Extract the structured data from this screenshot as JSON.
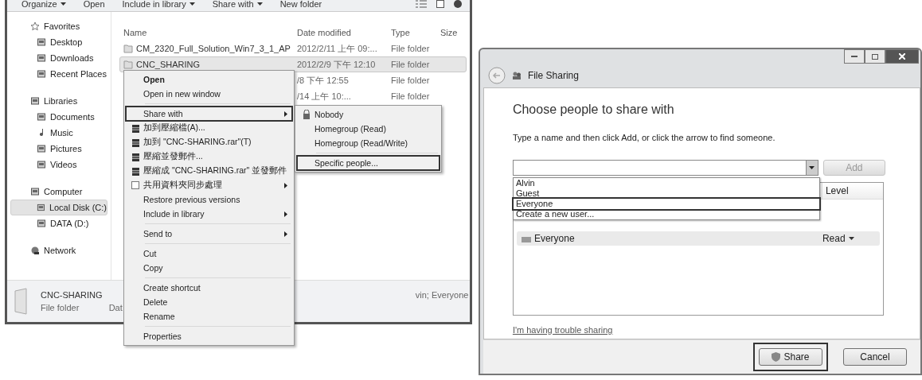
{
  "explorer": {
    "toolbar": [
      {
        "label": "Organize",
        "dropdown": true
      },
      {
        "label": "Open",
        "dropdown": false
      },
      {
        "label": "Include in library",
        "dropdown": true
      },
      {
        "label": "Share with",
        "dropdown": true
      },
      {
        "label": "New folder",
        "dropdown": false
      }
    ],
    "sidebar": [
      {
        "label": "Favorites",
        "children": [
          {
            "label": "Desktop",
            "selected": false
          },
          {
            "label": "Downloads",
            "selected": false
          },
          {
            "label": "Recent Places",
            "selected": false
          }
        ]
      },
      {
        "label": "Libraries",
        "children": [
          {
            "label": "Documents",
            "selected": false
          },
          {
            "label": "Music",
            "selected": false
          },
          {
            "label": "Pictures",
            "selected": false
          },
          {
            "label": "Videos",
            "selected": false
          }
        ]
      },
      {
        "label": "Computer",
        "children": [
          {
            "label": "Local Disk (C:)",
            "selected": true
          },
          {
            "label": "DATA (D:)",
            "selected": false
          }
        ]
      },
      {
        "label": "Network"
      }
    ],
    "columns": [
      "Name",
      "Date modified",
      "Type",
      "Size"
    ],
    "rows": [
      {
        "name": "CM_2320_Full_Solution_Win7_3_1_AP",
        "date": "2012/2/11 上午 09:...",
        "type": "File folder",
        "selected": false
      },
      {
        "name": "CNC_SHARING",
        "date": "2012/2/9 下午 12:10",
        "type": "File folder",
        "selected": true
      },
      {
        "date": "/8 下午 12:55",
        "type": "File folder",
        "selected": false
      },
      {
        "date": "/14 上午 10:...",
        "type": "File folder",
        "selected": false
      }
    ],
    "status": {
      "name": "CNC-SHARING",
      "type": "File folder",
      "date_label": "Dat",
      "shared_with": "vin; Everyone"
    }
  },
  "context_menu": {
    "items": [
      {
        "kind": "item",
        "label": "Open",
        "bold": true
      },
      {
        "kind": "item",
        "label": "Open in new window"
      },
      {
        "kind": "separator"
      },
      {
        "kind": "submenu",
        "label": "Share with",
        "annotated": true
      },
      {
        "kind": "item",
        "label": "加到壓縮檔(A)..."
      },
      {
        "kind": "item",
        "label": "加到 \"CNC-SHARING.rar\"(T)"
      },
      {
        "kind": "item",
        "label": "壓縮並發郵件..."
      },
      {
        "kind": "item",
        "label": "壓縮成 \"CNC-SHARING.rar\" 並發郵件"
      },
      {
        "kind": "submenu",
        "label": "共用資料夾同步處理"
      },
      {
        "kind": "item",
        "label": "Restore previous versions"
      },
      {
        "kind": "submenu",
        "label": "Include in library"
      },
      {
        "kind": "separator"
      },
      {
        "kind": "submenu",
        "label": "Send to"
      },
      {
        "kind": "separator"
      },
      {
        "kind": "item",
        "label": "Cut"
      },
      {
        "kind": "item",
        "label": "Copy"
      },
      {
        "kind": "separator"
      },
      {
        "kind": "item",
        "label": "Create shortcut"
      },
      {
        "kind": "item",
        "label": "Delete"
      },
      {
        "kind": "item",
        "label": "Rename"
      },
      {
        "kind": "separator"
      },
      {
        "kind": "item",
        "label": "Properties"
      }
    ]
  },
  "share_submenu": {
    "items": [
      {
        "kind": "item",
        "label": "Nobody",
        "annotated": false
      },
      {
        "kind": "item",
        "label": "Homegroup (Read)",
        "annotated": false
      },
      {
        "kind": "item",
        "label": "Homegroup (Read/Write)",
        "annotated": false
      },
      {
        "kind": "separator"
      },
      {
        "kind": "item",
        "label": "Specific people...",
        "annotated": true
      }
    ]
  },
  "dialog": {
    "title": "File Sharing",
    "heading": "Choose people to share with",
    "instruction": "Type a name and then click Add, or click the arrow to find someone.",
    "add_button": {
      "label": "Add",
      "disabled": true
    },
    "dropdown": [
      {
        "label": "Alvin",
        "annotated": false
      },
      {
        "label": "Guest",
        "annotated": false
      },
      {
        "label": "Everyone",
        "annotated": true
      },
      {
        "label": "Create a new user..."
      }
    ],
    "table": {
      "column_2": "Level",
      "rows": [
        {
          "name": "Everyone",
          "level": "Read"
        }
      ]
    },
    "link": "I'm having trouble sharing",
    "buttons": [
      {
        "label": "Share",
        "annotated": true,
        "shield": true
      },
      {
        "label": "Cancel",
        "annotated": false,
        "shield": false
      }
    ]
  }
}
